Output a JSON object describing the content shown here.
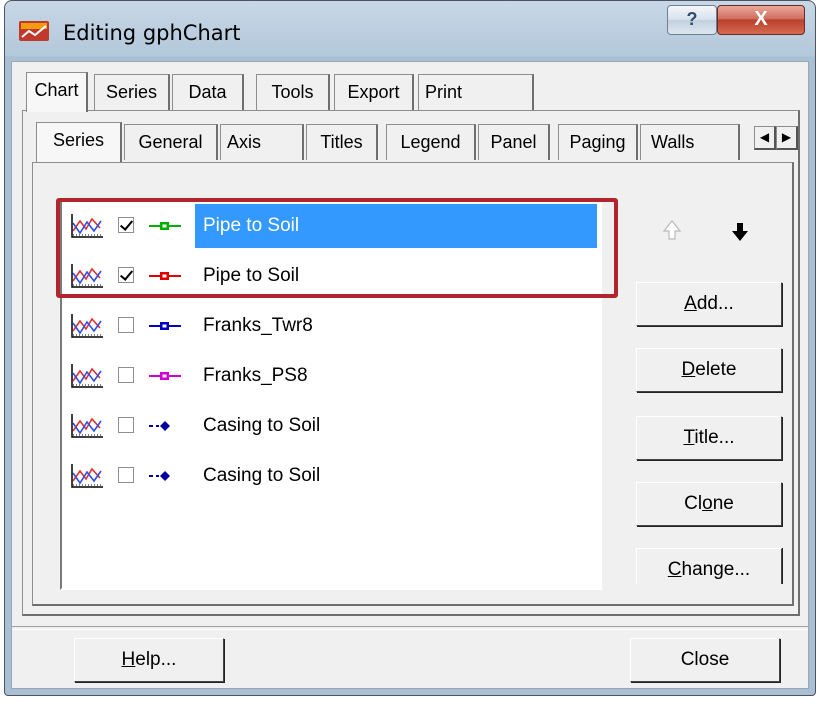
{
  "window": {
    "title": "Editing gphChart",
    "help_glyph": "?",
    "close_glyph": "X"
  },
  "main_tabs": [
    {
      "label": "Chart",
      "active": true
    },
    {
      "label": "Series"
    },
    {
      "label": "Data"
    },
    {
      "label": "Tools"
    },
    {
      "label": "Export"
    },
    {
      "label": "Print"
    }
  ],
  "sub_tabs": [
    {
      "label": "Series",
      "active": true
    },
    {
      "label": "General"
    },
    {
      "label": "Axis"
    },
    {
      "label": "Titles"
    },
    {
      "label": "Legend"
    },
    {
      "label": "Panel"
    },
    {
      "label": "Paging"
    },
    {
      "label": "Walls"
    }
  ],
  "tab_scroll": {
    "left": "◀",
    "right": "▶"
  },
  "series_list": [
    {
      "label": "Pipe to Soil",
      "checked": true,
      "selected": true,
      "marker_color": "#00b000",
      "marker_style": "square-line"
    },
    {
      "label": "Pipe to Soil",
      "checked": true,
      "selected": false,
      "marker_color": "#e00000",
      "marker_style": "square-line"
    },
    {
      "label": "Franks_Twr8",
      "checked": false,
      "selected": false,
      "marker_color": "#0000c0",
      "marker_style": "square-line"
    },
    {
      "label": "Franks_PS8",
      "checked": false,
      "selected": false,
      "marker_color": "#d000d0",
      "marker_style": "square-line"
    },
    {
      "label": "Casing to Soil",
      "checked": false,
      "selected": false,
      "marker_color": "#0000a0",
      "marker_style": "diamond-dash"
    },
    {
      "label": "Casing to Soil",
      "checked": false,
      "selected": false,
      "marker_color": "#0000a0",
      "marker_style": "diamond-dash"
    }
  ],
  "buttons": {
    "add": {
      "pre": "",
      "key": "A",
      "post": "dd..."
    },
    "delete": {
      "pre": "",
      "key": "D",
      "post": "elete"
    },
    "title": {
      "pre": "",
      "key": "T",
      "post": "itle..."
    },
    "clone": {
      "pre": "Cl",
      "key": "o",
      "post": "ne"
    },
    "change": {
      "pre": "",
      "key": "C",
      "post": "hange..."
    },
    "help": {
      "pre": "",
      "key": "H",
      "post": "elp..."
    },
    "close": {
      "pre": "Close",
      "key": "",
      "post": ""
    }
  },
  "icons": {
    "app": "chart-app-icon",
    "series_type": "line-series-icon",
    "move_up": "arrow-up-icon",
    "move_down": "arrow-down-icon"
  },
  "colors": {
    "selection": "#3399ff",
    "highlight_frame": "#b2252c"
  }
}
